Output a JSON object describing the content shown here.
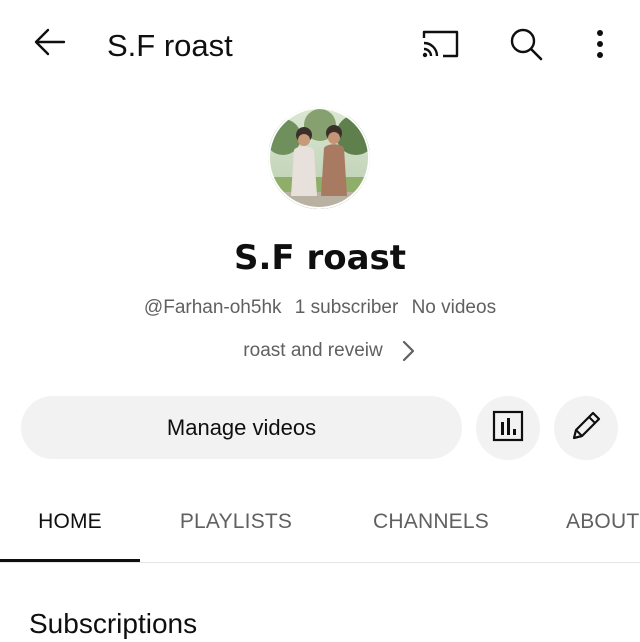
{
  "header": {
    "title": "S.F roast",
    "back_icon": "arrow-left-icon",
    "cast_icon": "cast-icon",
    "search_icon": "search-icon",
    "more_icon": "more-vertical-icon"
  },
  "channel": {
    "avatar": "channel-avatar",
    "name": "S.F roast",
    "handle": "@Farhan-oh5hk",
    "subscribers": "1 subscriber",
    "videos": "No videos",
    "description": "roast and reveiw"
  },
  "actions": {
    "manage_label": "Manage videos",
    "analytics_icon": "analytics-icon",
    "edit_icon": "pencil-icon"
  },
  "tabs": [
    {
      "label": "HOME",
      "active": true
    },
    {
      "label": "PLAYLISTS",
      "active": false
    },
    {
      "label": "CHANNELS",
      "active": false
    },
    {
      "label": "ABOUT",
      "active": false
    }
  ],
  "section": {
    "title": "Subscriptions"
  },
  "colors": {
    "text_primary": "#0f0f0f",
    "text_secondary": "#606060",
    "button_bg": "#f2f2f2",
    "divider": "#e5e5e5"
  }
}
